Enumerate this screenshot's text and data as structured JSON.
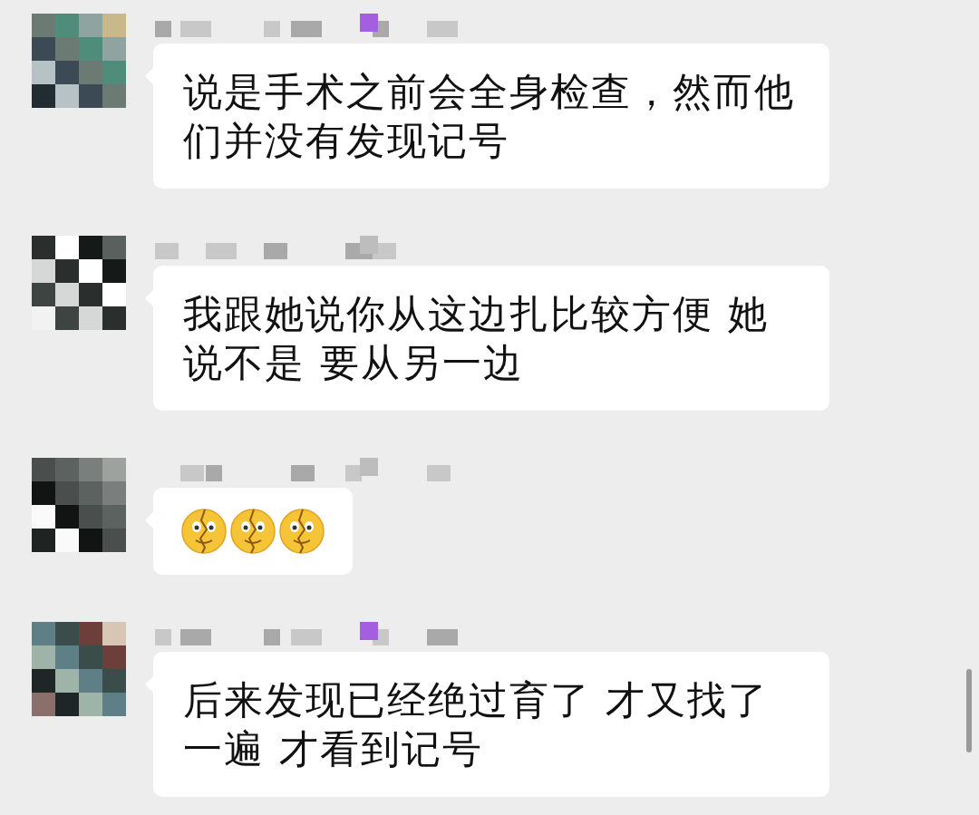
{
  "messages": [
    {
      "kind": "text",
      "text": "说是手术之前会全身检查，然而他们并没有发现记号"
    },
    {
      "kind": "text",
      "text": "我跟她说你从这边扎比较方便 她说不是 要从另一边"
    },
    {
      "kind": "emoji",
      "emojis": [
        {
          "kind": "cracked-face"
        },
        {
          "kind": "cracked-face"
        },
        {
          "kind": "cracked-face"
        }
      ]
    },
    {
      "kind": "text",
      "text": "后来发现已经绝过育了 才又找了一遍 才看到记号"
    }
  ]
}
